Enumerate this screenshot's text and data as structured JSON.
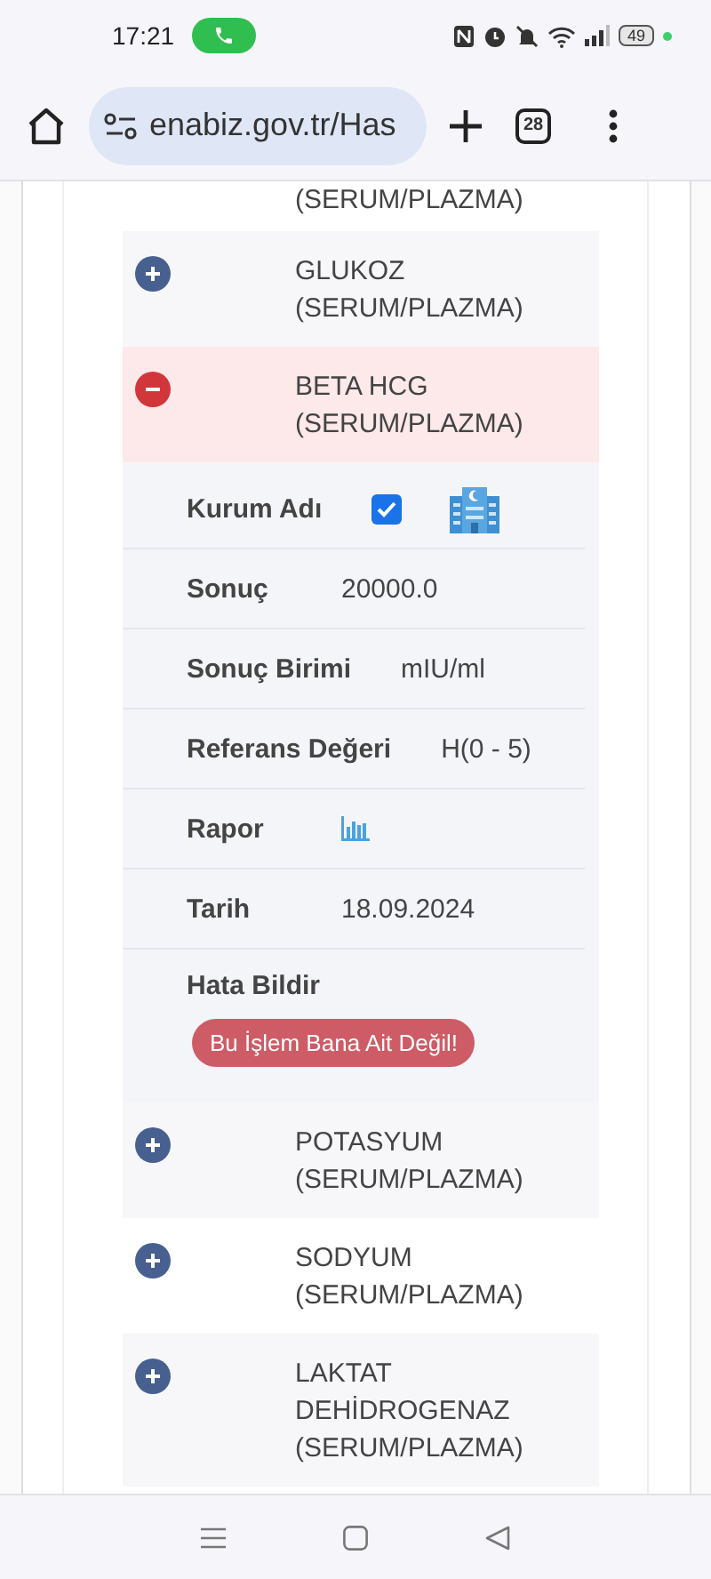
{
  "status_bar": {
    "time": "17:21",
    "battery": "49"
  },
  "browser": {
    "url": "enabiz.gov.tr/Has",
    "tab_count": "28"
  },
  "top_fragment": "(SERUM/PLAZMA)",
  "tests": [
    {
      "name": "GLUKOZ\n(SERUM/PLAZMA)",
      "expanded": false
    },
    {
      "name": "BETA HCG\n(SERUM/PLAZMA)",
      "expanded": true,
      "details": [
        {
          "kind": "checkbox",
          "label": "Kurum Adı",
          "checked": true
        },
        {
          "kind": "text",
          "label": "Sonuç",
          "value": "20000.0"
        },
        {
          "kind": "text",
          "label": "Sonuç Birimi",
          "value": "mIU/ml"
        },
        {
          "kind": "text",
          "label": "Referans Değeri",
          "value": "H(0 - 5)"
        },
        {
          "kind": "report",
          "label": "Rapor"
        },
        {
          "kind": "text",
          "label": "Tarih",
          "value": "18.09.2024"
        },
        {
          "kind": "action",
          "label": "Hata Bildir",
          "button": "Bu İşlem Bana Ait Değil!"
        }
      ]
    },
    {
      "name": "POTASYUM\n(SERUM/PLAZMA)",
      "expanded": false
    },
    {
      "name": "SODYUM\n(SERUM/PLAZMA)",
      "expanded": false
    },
    {
      "name": "LAKTAT\nDEHİDROGENAZ\n(SERUM/PLAZMA)",
      "expanded": false
    }
  ]
}
